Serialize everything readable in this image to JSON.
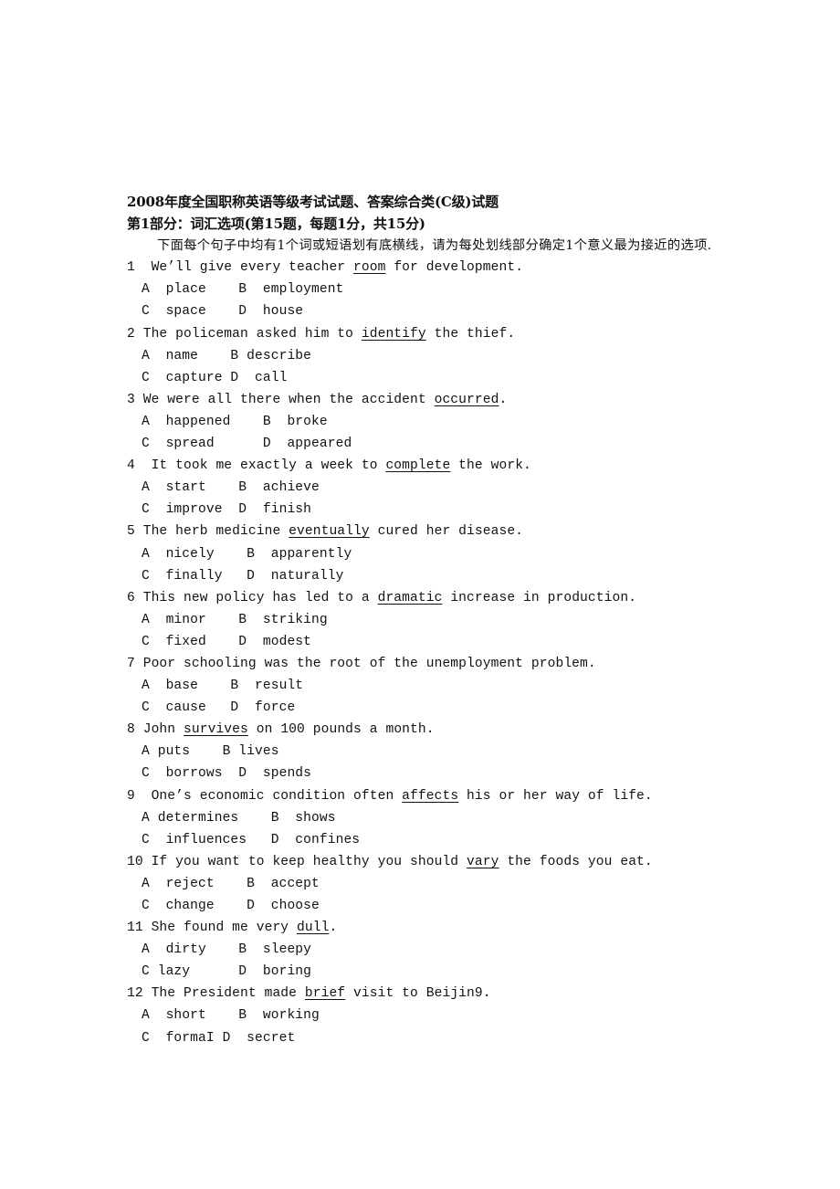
{
  "document": {
    "title": "2008年度全国职称英语等级考试试题、答案综合类(C级)试题",
    "section_heading": "第1部分：词汇选项(第15题，每题1分，共15分)",
    "instructions": "下面每个句子中均有1个词或短语划有底横线，请为每处划线部分确定1个意义最为接近的选项.",
    "questions": [
      {
        "number": "1 ",
        "before": " We’ll give every teacher ",
        "underlined": "room",
        "after": " for development.",
        "options_line1": "A  place    B  employment",
        "options_line2": "C  space    D  house"
      },
      {
        "number": "2",
        "before": " The policeman asked him to ",
        "underlined": "identify",
        "after": " the thief.",
        "options_line1": "A  name    B describe",
        "options_line2": "C  capture D  call"
      },
      {
        "number": "3",
        "before": " We were all there when the accident ",
        "underlined": "occurred",
        "after": ".",
        "options_line1": "A  happened    B  broke",
        "options_line2": "C  spread      D  appeared"
      },
      {
        "number": "4 ",
        "before": " It took me exactly a week to ",
        "underlined": "complete",
        "after": " the work.",
        "options_line1": "A  start    B  achieve",
        "options_line2": "C  improve  D  finish"
      },
      {
        "number": "5",
        "before": " The herb medicine ",
        "underlined": "eventually",
        "after": " cured her disease.",
        "options_line1": "A  nicely    B  apparently",
        "options_line2": "C  finally   D  naturally"
      },
      {
        "number": "6",
        "before": " This new policy has led to a ",
        "underlined": "dramatic",
        "after": " increase in production.",
        "options_line1": "A  minor    B  striking",
        "options_line2": "C  fixed    D  modest"
      },
      {
        "number": "7",
        "before": " Poor schooling was the root of the unemployment problem.",
        "underlined": "",
        "after": "",
        "options_line1": "A  base    B  result",
        "options_line2": "C  cause   D  force"
      },
      {
        "number": "8",
        "before": " John ",
        "underlined": "survives",
        "after": " on 100 pounds a month.",
        "options_line1": "A puts    B lives",
        "options_line2": "C  borrows  D  spends"
      },
      {
        "number": "9 ",
        "before": " One’s economic condition often ",
        "underlined": "affects",
        "after": " his or her way of life.",
        "options_line1": "A determines    B  shows",
        "options_line2": "C  influences   D  confines"
      },
      {
        "number": "10",
        "before": " If you want to keep healthy you should ",
        "underlined": "vary",
        "after": " the foods you eat.",
        "options_line1": "A  reject    B  accept",
        "options_line2": "C  change    D  choose"
      },
      {
        "number": "11",
        "before": " She found me very ",
        "underlined": "dull",
        "after": ".",
        "options_line1": "A  dirty    B  sleepy",
        "options_line2": "C lazy      D  boring"
      },
      {
        "number": "12",
        "before": " The President made ",
        "underlined": "brief",
        "after": " visit to Beijin9.",
        "options_line1": "A  short    B  working",
        "options_line2": "C  formaI D  secret"
      }
    ]
  }
}
